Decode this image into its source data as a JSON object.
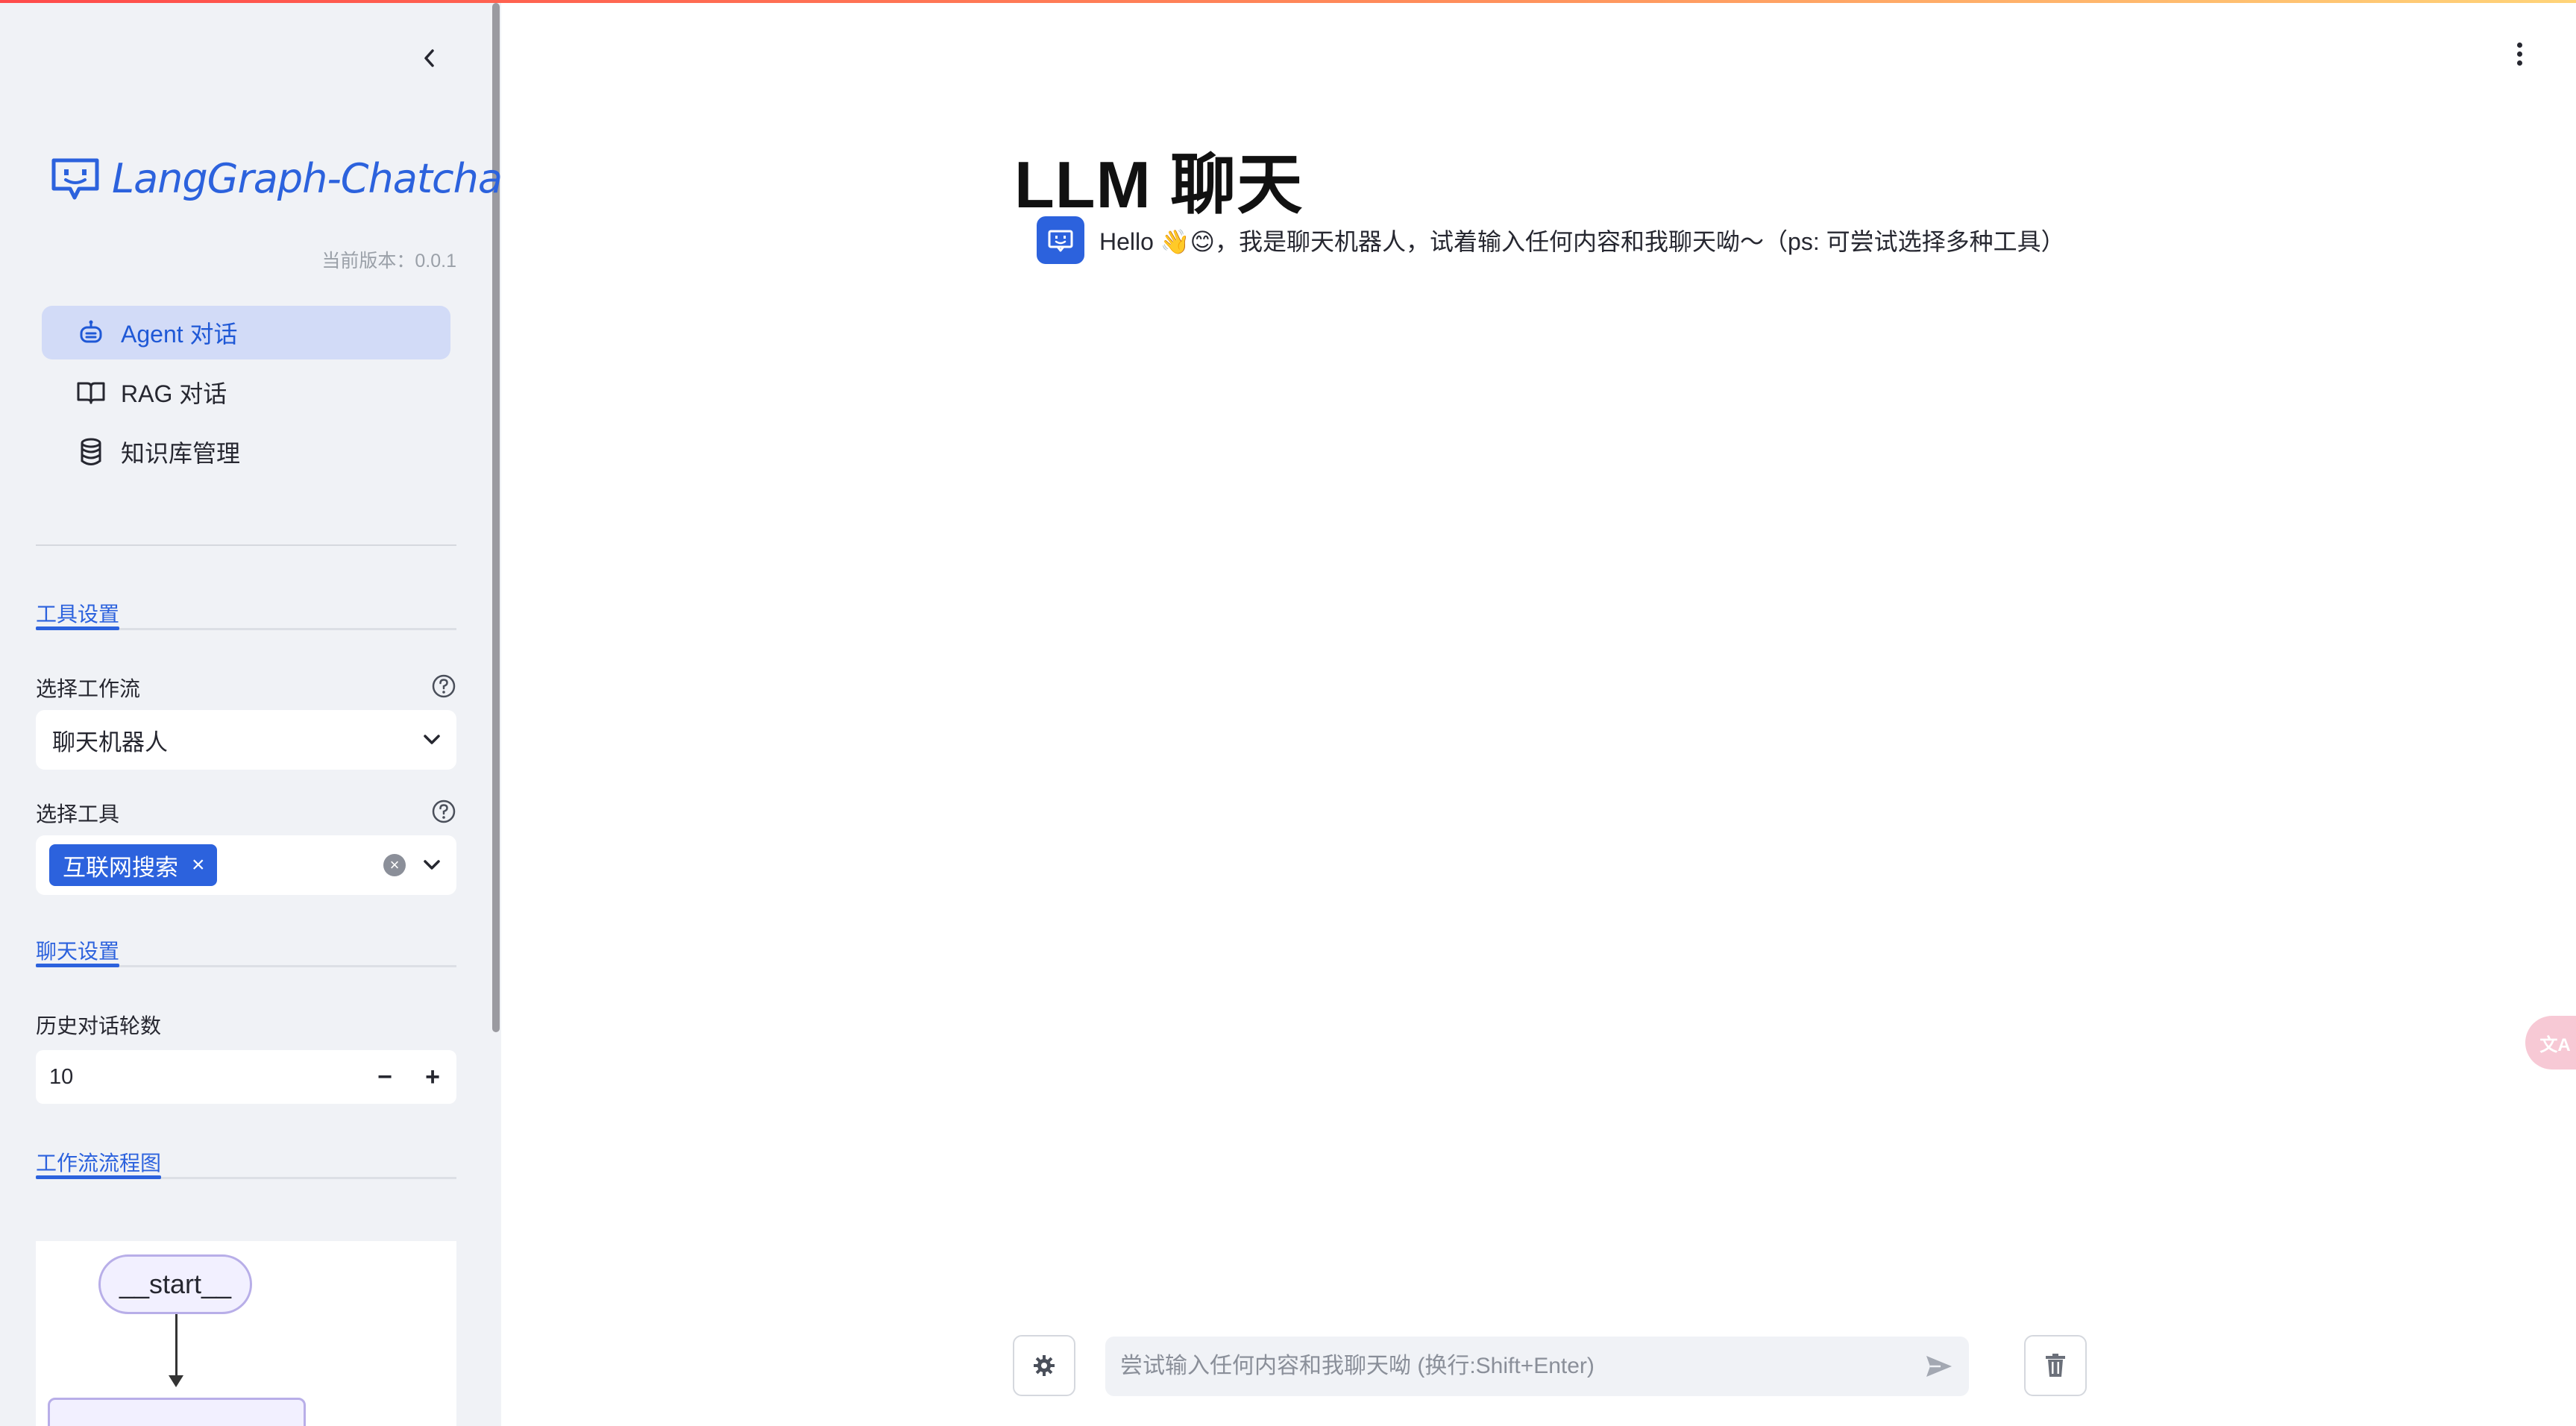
{
  "app": {
    "title": "LangGraph-Chatchat",
    "version_text": "当前版本：0.0.1"
  },
  "sidebar": {
    "nav": [
      {
        "label": "Agent 对话",
        "icon": "robot-icon",
        "active": true
      },
      {
        "label": "RAG 对话",
        "icon": "book-icon",
        "active": false
      },
      {
        "label": "知识库管理",
        "icon": "database-icon",
        "active": false
      }
    ],
    "tool_settings": {
      "tab_label": "工具设置",
      "workflow_label": "选择工作流",
      "workflow_value": "聊天机器人",
      "tools_label": "选择工具",
      "selected_tools": [
        "互联网搜索"
      ]
    },
    "chat_settings": {
      "tab_label": "聊天设置",
      "history_label": "历史对话轮数",
      "history_value": "10",
      "decrement": "−",
      "increment": "+"
    },
    "workflow_graph": {
      "tab_label": "工作流流程图",
      "start_node": "__start__"
    }
  },
  "main": {
    "title": "LLM 聊天",
    "welcome_message": "Hello 👋😊，我是聊天机器人，试着输入任何内容和我聊天呦～（ps: 可尝试选择多种工具）",
    "input_placeholder": "尝试输入任何内容和我聊天呦 (换行:Shift+Enter)"
  },
  "floating": {
    "translate_label": "文A"
  },
  "colors": {
    "accent": "#2c62dd",
    "sidebar_bg": "#f0f2f6",
    "active_nav_bg": "#d2dbf7"
  }
}
